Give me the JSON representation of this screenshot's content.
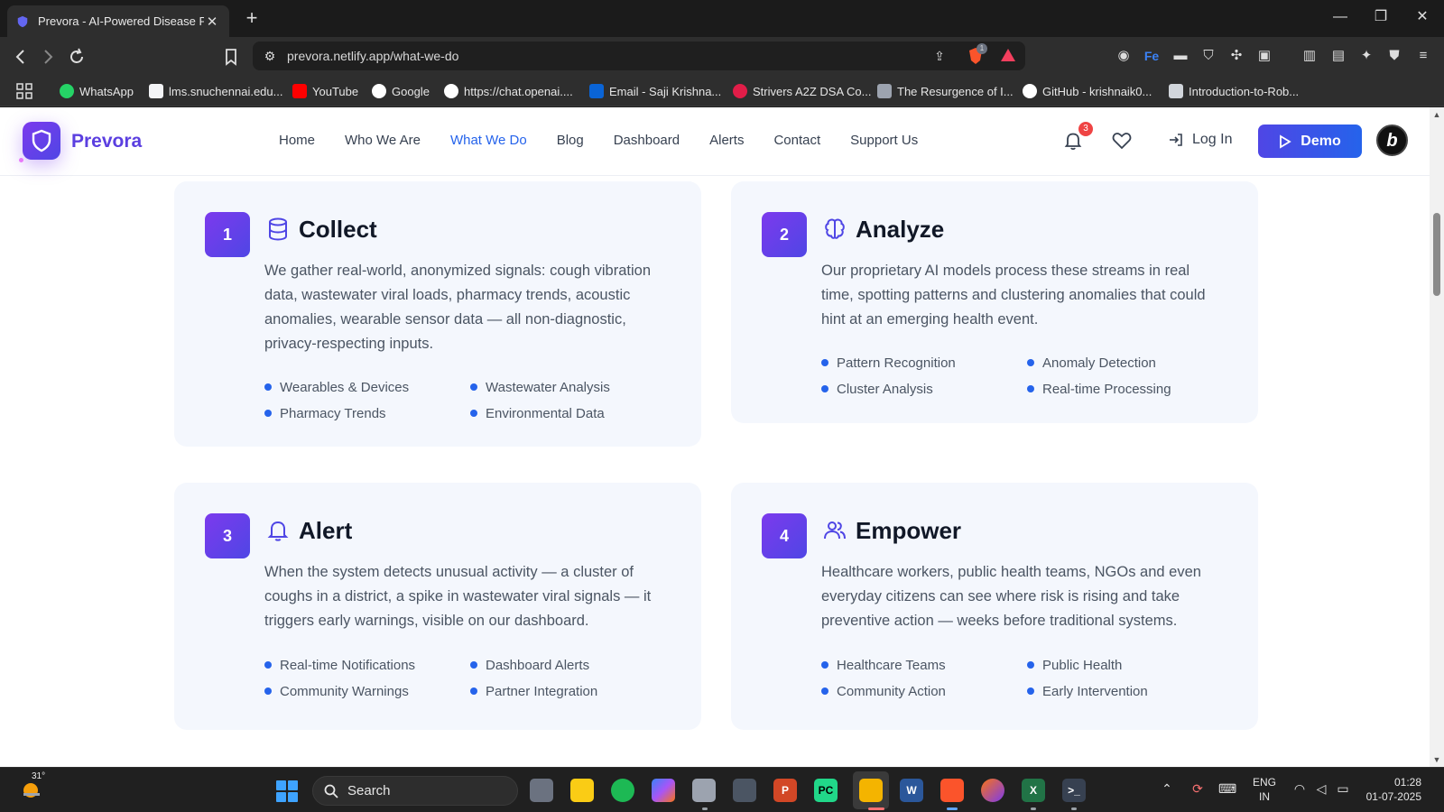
{
  "browser": {
    "tab_title": "Prevora - AI-Powered Disease Pr",
    "url": "prevora.netlify.app/what-we-do",
    "shield_count": "1",
    "bookmarks": [
      {
        "label": "WhatsApp",
        "color": "#25d366"
      },
      {
        "label": "lms.snuchennai.edu...",
        "color": "#f3f4f6"
      },
      {
        "label": "YouTube",
        "color": "#ff0000"
      },
      {
        "label": "Google",
        "color": "#ffffff"
      },
      {
        "label": "https://chat.openai....",
        "color": "#ffffff"
      },
      {
        "label": "Email - Saji Krishna...",
        "color": "#0a64d6"
      },
      {
        "label": "Strivers A2Z DSA Co...",
        "color": "#e11d48"
      },
      {
        "label": "The Resurgence of I...",
        "color": "#9ca3af"
      },
      {
        "label": "GitHub - krishnaik0...",
        "color": "#ffffff"
      },
      {
        "label": "Introduction-to-Rob...",
        "color": "#d1d5db"
      }
    ]
  },
  "header": {
    "brand": "Prevora",
    "nav": [
      "Home",
      "Who We Are",
      "What We Do",
      "Blog",
      "Dashboard",
      "Alerts",
      "Contact",
      "Support Us"
    ],
    "active_nav": "What We Do",
    "notification_count": "3",
    "login_label": "Log In",
    "demo_label": "Demo",
    "avatar_letter": "b",
    "accent_color": "#2563eb",
    "brand_gradient": [
      "#7c3aed",
      "#4f46e5"
    ]
  },
  "steps": [
    {
      "number": "1",
      "icon": "database-icon",
      "title": "Collect",
      "description": "We gather real-world, anonymized signals: cough vibration data, wastewater viral loads, pharmacy trends, acoustic anomalies, wearable sensor data — all non-diagnostic, privacy-respecting inputs.",
      "features": [
        "Wearables & Devices",
        "Wastewater Analysis",
        "Pharmacy Trends",
        "Environmental Data"
      ]
    },
    {
      "number": "2",
      "icon": "brain-icon",
      "title": "Analyze",
      "description": "Our proprietary AI models process these streams in real time, spotting patterns and clustering anomalies that could hint at an emerging health event.",
      "features": [
        "Pattern Recognition",
        "Anomaly Detection",
        "Cluster Analysis",
        "Real-time Processing"
      ]
    },
    {
      "number": "3",
      "icon": "bell-icon",
      "title": "Alert",
      "description": "When the system detects unusual activity — a cluster of coughs in a district, a spike in wastewater viral signals — it triggers early warnings, visible on our dashboard.",
      "features": [
        "Real-time Notifications",
        "Dashboard Alerts",
        "Community Warnings",
        "Partner Integration"
      ]
    },
    {
      "number": "4",
      "icon": "users-icon",
      "title": "Empower",
      "description": "Healthcare workers, public health teams, NGOs and even everyday citizens can see where risk is rising and take preventive action — weeks before traditional systems.",
      "features": [
        "Healthcare Teams",
        "Public Health",
        "Community Action",
        "Early Intervention"
      ]
    }
  ],
  "taskbar": {
    "weather_temp": "31°",
    "search_label": "Search",
    "lang_line1": "ENG",
    "lang_line2": "IN",
    "time": "01:28",
    "date": "01-07-2025"
  }
}
